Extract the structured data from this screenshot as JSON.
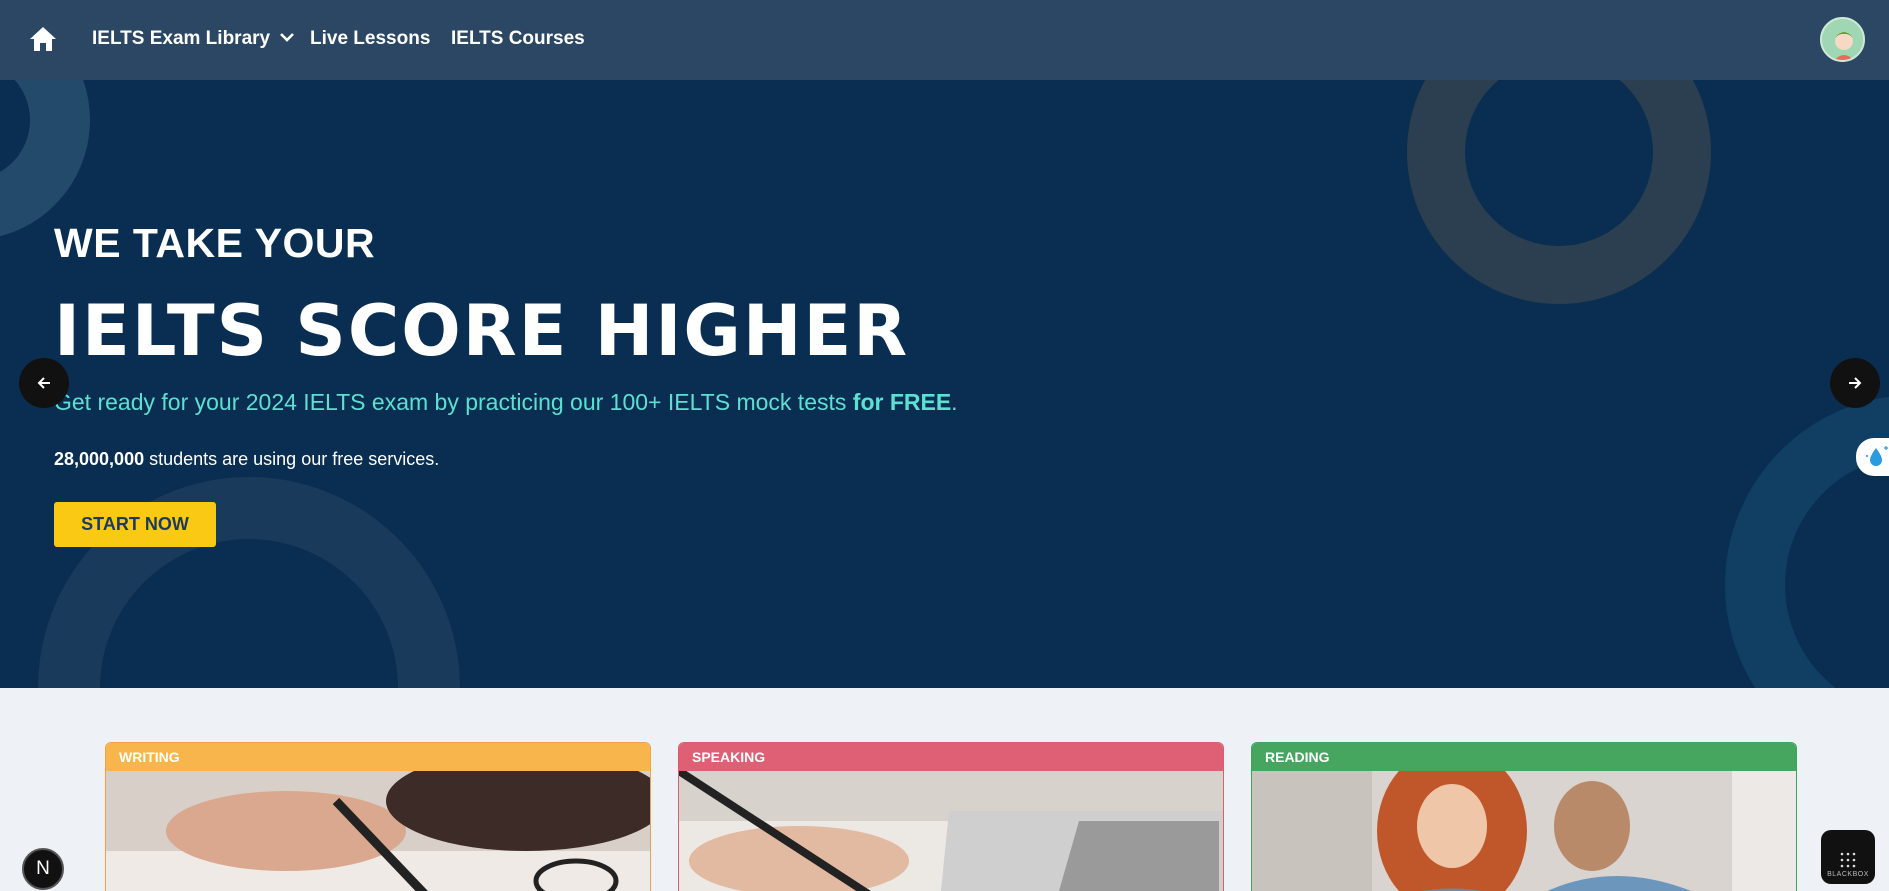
{
  "nav": {
    "home_icon": "home-icon",
    "links": [
      {
        "label": "IELTS Exam Library",
        "has_dropdown": true
      },
      {
        "label": "Live Lessons"
      },
      {
        "label": "IELTS Courses"
      }
    ],
    "avatar_icon": "user-avatar"
  },
  "hero": {
    "kicker": "WE TAKE YOUR",
    "title": "IELTS SCORE HIGHER",
    "subtitle_main": "Get ready for your 2024 IELTS exam by practicing our 100+ IELTS mock tests ",
    "subtitle_bold": "for FREE",
    "subtitle_end": ".",
    "stat_count": "28,000,000",
    "stat_text": " students are using our free services.",
    "cta_label": "START NOW",
    "prev_icon": "arrow-left-icon",
    "next_icon": "arrow-right-icon"
  },
  "cards": [
    {
      "label": "WRITING",
      "color": "#f7b54c"
    },
    {
      "label": "SPEAKING",
      "color": "#df6075"
    },
    {
      "label": "READING",
      "color": "#46a660"
    }
  ],
  "colors": {
    "nav_bg": "#2c4763",
    "hero_bg": "#092e51",
    "accent_teal": "#5ce0d2",
    "cta_yellow": "#f9c913"
  },
  "badges": {
    "n_label": "N",
    "blackbox_label": "BLACKBOX"
  }
}
